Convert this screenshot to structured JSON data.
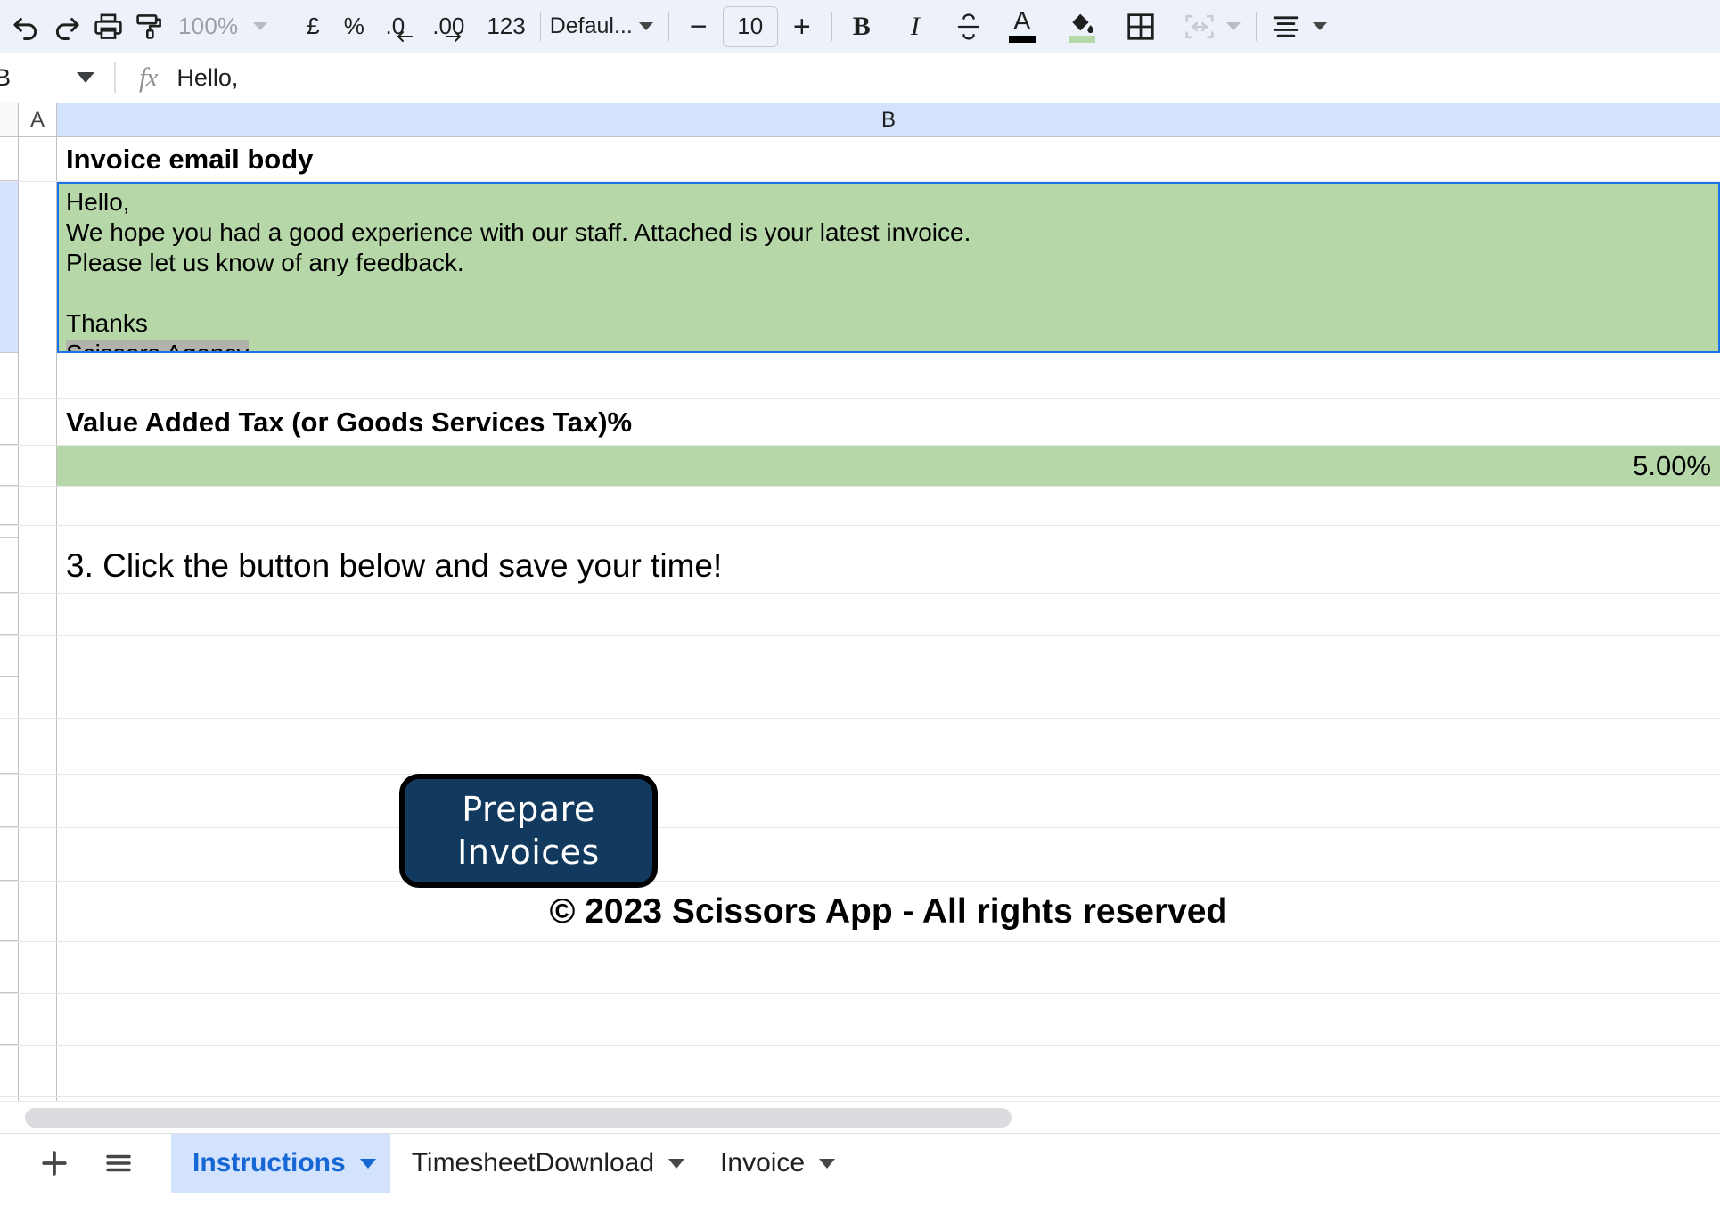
{
  "toolbar": {
    "undo_label": "undo-icon",
    "redo_label": "redo-icon",
    "print_label": "print-icon",
    "paint_label": "paint-format-icon",
    "zoom_value": "100%",
    "currency_label": "£",
    "percent_label": "%",
    "decrease_decimal_label": ".0",
    "increase_decimal_label": ".00",
    "more_formats_label": "123",
    "font_name": "Defaul...",
    "font_size": "10",
    "decrease_font": "−",
    "increase_font": "+",
    "bold_label": "B",
    "italic_label": "I",
    "strikethrough_label": "S",
    "text_color_label": "A",
    "fill_color_swatch": "#b6d7a8",
    "text_color_swatch": "#000000",
    "borders_label": "borders-icon",
    "merge_label": "merge-cells-icon",
    "align_label": "horizontal-align-icon"
  },
  "formula_bar": {
    "name_box_value": "B",
    "fx_label": "fx",
    "formula_value": "Hello,"
  },
  "grid": {
    "columns": [
      "A",
      "B"
    ],
    "selected_column": "B",
    "email_header": "Invoice email body",
    "email_body_lines": [
      "Hello,",
      "We hope you had a good experience with our staff. Attached is your latest invoice.",
      "Please let us know of any feedback.",
      "",
      "Thanks",
      "Scissors Agency"
    ],
    "email_body_highlighted_line": "Scissors Agency",
    "vat_header": "Value Added Tax (or Goods Services Tax)%",
    "vat_value": "5.00%",
    "instruction_text": "3. Click the button below and save your time!",
    "button_line1": "Prepare",
    "button_line2": "Invoices",
    "copyright": "© 2023 Scissors App - All rights reserved",
    "cell_fill_color": "#b6d7a8",
    "selection_border_color": "#1a73e8",
    "button_fill_color": "#123a5e"
  },
  "sheet_tabs": {
    "add_sheet_label": "+",
    "all_sheets_label": "all-sheets-icon",
    "tabs": [
      {
        "label": "Instructions",
        "active": true
      },
      {
        "label": "TimesheetDownload",
        "active": false
      },
      {
        "label": "Invoice",
        "active": false
      }
    ]
  }
}
